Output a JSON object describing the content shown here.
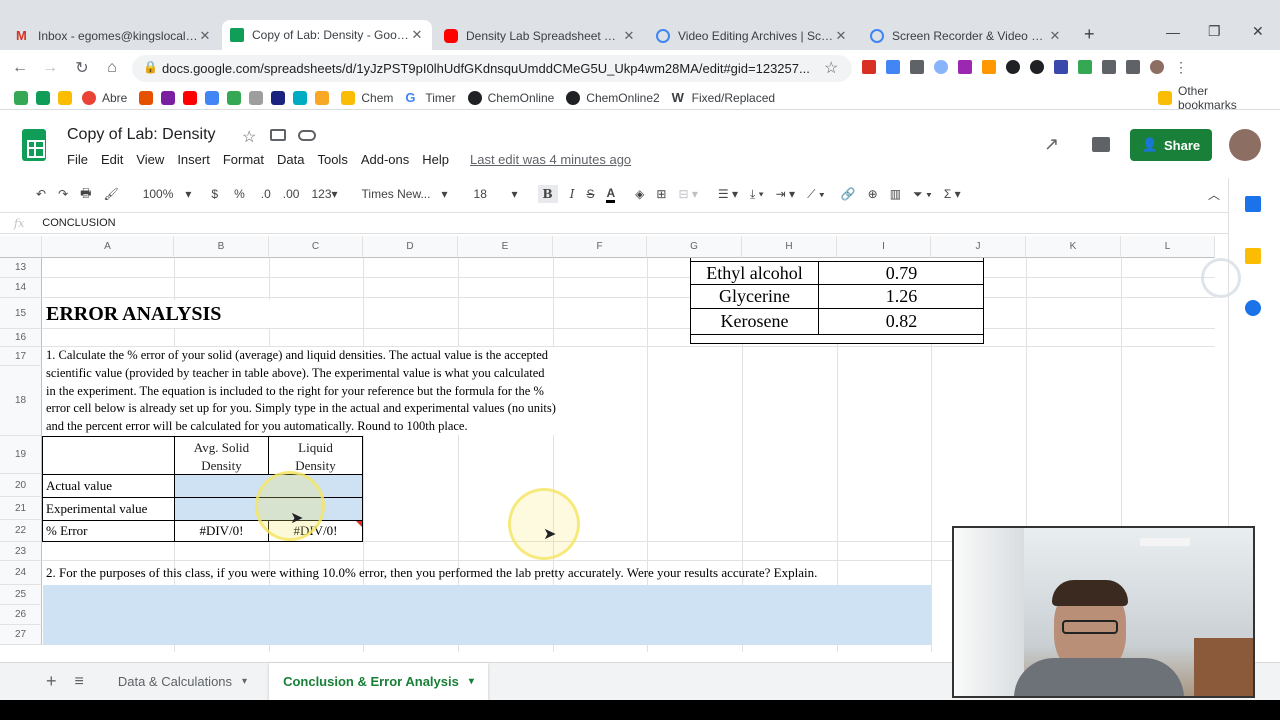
{
  "browser": {
    "tabs": [
      {
        "title": "Inbox - egomes@kingslocal.ne",
        "color": "#d93025"
      },
      {
        "title": "Copy of Lab: Density - Google",
        "color": "#0f9d58"
      },
      {
        "title": "Density Lab Spreadsheet Tuto",
        "color": "#ff0000"
      },
      {
        "title": "Video Editing Archives | Scree",
        "color": "#4285f4"
      },
      {
        "title": "Screen Recorder & Video Edit",
        "color": "#4285f4"
      }
    ],
    "url": "docs.google.com/spreadsheets/d/1yJzPST9pI0lhUdfGKdnsquUmddCMeG5U_Ukp4wm28MA/edit#gid=123257...",
    "bookmarks": [
      "Abre",
      "Chem",
      "Timer",
      "ChemOnline",
      "ChemOnline2",
      "Fixed/Replaced"
    ],
    "other_bookmarks": "Other bookmarks"
  },
  "doc": {
    "title": "Copy of Lab: Density",
    "menu": [
      "File",
      "Edit",
      "View",
      "Insert",
      "Format",
      "Data",
      "Tools",
      "Add-ons",
      "Help"
    ],
    "last_edit": "Last edit was 4 minutes ago",
    "share": "Share"
  },
  "toolbar": {
    "zoom": "100%",
    "currency": "$",
    "percent": "%",
    "dec_less": ".0",
    "dec_more": ".00",
    "format": "123",
    "font": "Times New...",
    "size": "18"
  },
  "formula_bar": {
    "fx": "fx",
    "value": "CONCLUSION"
  },
  "columns": [
    "A",
    "B",
    "C",
    "D",
    "E",
    "F",
    "G",
    "H",
    "I",
    "J",
    "K",
    "L"
  ],
  "rows": [
    "13",
    "14",
    "15",
    "16",
    "17",
    "18",
    "19",
    "20",
    "21",
    "22",
    "23",
    "24",
    "25",
    "26",
    "27"
  ],
  "density_table": [
    {
      "substance": "Ethyl alcohol",
      "value": "0.79"
    },
    {
      "substance": "Glycerine",
      "value": "1.26"
    },
    {
      "substance": "Kerosene",
      "value": "0.82"
    }
  ],
  "content": {
    "heading": "ERROR ANALYSIS",
    "q1_lines": [
      "1. Calculate the % error of your solid (average)  and liquid densities. The actual value is the accepted",
      "scientific value (provided by teacher in table above). The experimental value is what you calculated",
      "in the experiment. The equation is included to the right for your reference but the formula for the %",
      "error cell below is already set up for you. Simply type in the actual and experimental values (no units)",
      "and the percent error will be calculated for you automatically. Round to 100th place."
    ],
    "col_b_header_1": "Avg. Solid",
    "col_b_header_2": "Density",
    "col_c_header_1": "Liquid",
    "col_c_header_2": "Density",
    "row_actual": "Actual value",
    "row_experimental": "Experimental value",
    "row_error": "% Error",
    "error_b": "#DIV/0!",
    "error_c": "#DIV/0!",
    "q2": "2. For the purposes of this class, if you were withing 10.0% error, then you performed the lab pretty accurately. Were your results accurate? Explain."
  },
  "sheet_tabs": [
    "Data & Calculations",
    "Conclusion & Error Analysis"
  ],
  "colors": {
    "accent_green": "#188038",
    "input_fill": "#cfe2f3",
    "highlight": "#f5e663"
  }
}
